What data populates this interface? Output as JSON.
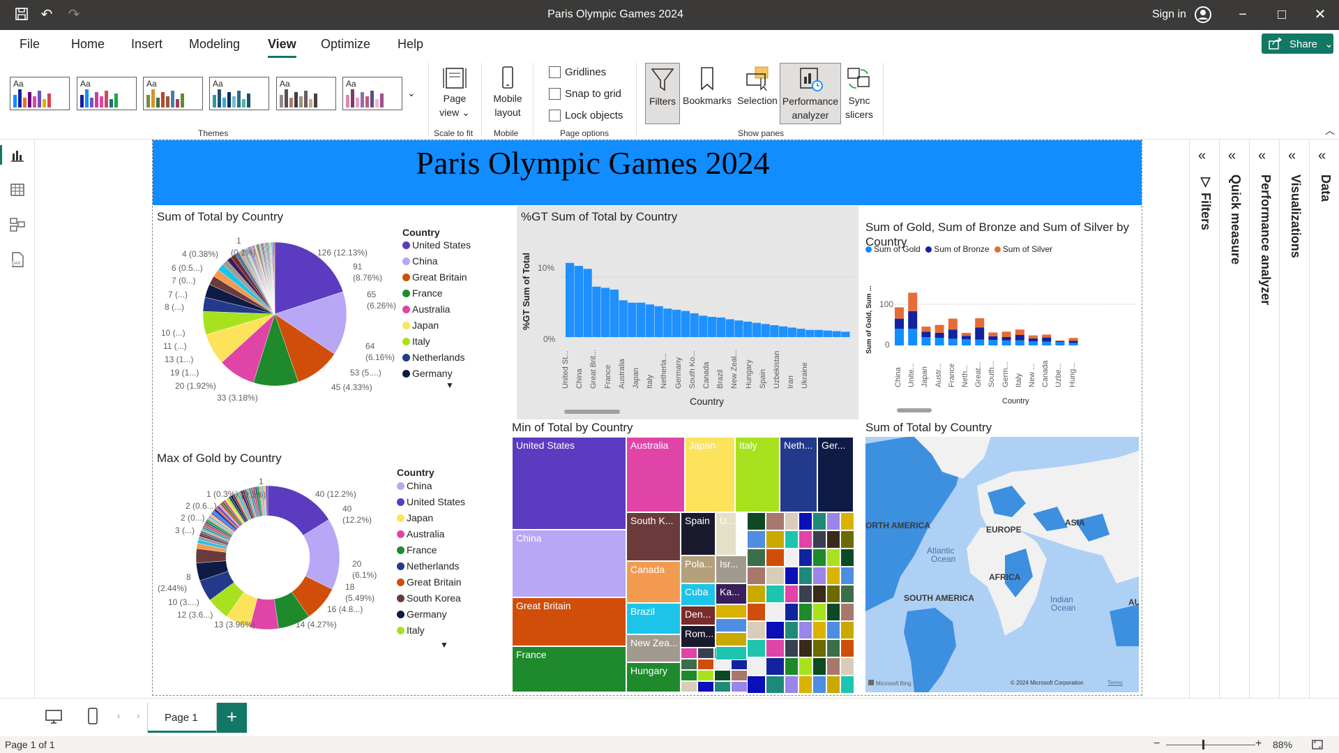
{
  "app": {
    "title": "Paris Olympic Games 2024",
    "sign_in": "Sign in",
    "share_label": "Share"
  },
  "ribbon_tabs": [
    "File",
    "Home",
    "Insert",
    "Modeling",
    "View",
    "Optimize",
    "Help"
  ],
  "active_tab": "View",
  "ribbon": {
    "themes_label": "Themes",
    "theme_tile_label": "Aa",
    "page_view": "Page view",
    "scale_to_fit": "Scale to fit",
    "mobile_layout": "Mobile layout",
    "mobile": "Mobile",
    "gridlines": "Gridlines",
    "snap_to_grid": "Snap to grid",
    "lock_objects": "Lock objects",
    "page_options": "Page options",
    "filters": "Filters",
    "bookmarks": "Bookmarks",
    "selection": "Selection",
    "performance_analyzer": "Performance analyzer",
    "sync_slicers": "Sync slicers",
    "show_panes": "Show panes"
  },
  "report": {
    "banner_title": "Paris Olympic Games 2024",
    "pie1": {
      "title": "Sum of Total by Country",
      "legend_title": "Country",
      "legend": [
        {
          "name": "United States",
          "color": "#5b3bbf"
        },
        {
          "name": "China",
          "color": "#b8a7f5"
        },
        {
          "name": "Great Britain",
          "color": "#d04e0a"
        },
        {
          "name": "France",
          "color": "#1e8a2c"
        },
        {
          "name": "Australia",
          "color": "#e044a7"
        },
        {
          "name": "Japan",
          "color": "#fde35b"
        },
        {
          "name": "Italy",
          "color": "#a8e21e"
        },
        {
          "name": "Netherlands",
          "color": "#233a8c"
        },
        {
          "name": "Germany",
          "color": "#0d1b45"
        }
      ],
      "labels": [
        "1",
        "4 (0.38%)",
        "(0.1%)",
        "126 (12.13%)",
        "6 (0.5...)",
        "91",
        "(8.76%)",
        "7 (0...)",
        "7 (...)",
        "65",
        "(6.26%)",
        "8 (...)",
        "10 (...)",
        "11 (...)",
        "64",
        "(6.16%)",
        "13 (1...)",
        "53 (5....)",
        "19 (1...)",
        "20 (1.92%)",
        "45 (4.33%)",
        "33 (3.18%)"
      ],
      "slices": [
        126,
        91,
        65,
        64,
        53,
        45,
        33,
        20,
        19,
        13,
        11,
        10,
        8,
        7,
        7,
        6,
        4,
        1
      ]
    },
    "donut": {
      "title": "Max of Gold by Country",
      "legend_title": "Country",
      "legend": [
        {
          "name": "China",
          "color": "#b8a7f5"
        },
        {
          "name": "United States",
          "color": "#5b3bbf"
        },
        {
          "name": "Japan",
          "color": "#fde35b"
        },
        {
          "name": "Australia",
          "color": "#e044a7"
        },
        {
          "name": "France",
          "color": "#1e8a2c"
        },
        {
          "name": "Netherlands",
          "color": "#233a8c"
        },
        {
          "name": "Great Britain",
          "color": "#d04e0a"
        },
        {
          "name": "South Korea",
          "color": "#6b3b3b"
        },
        {
          "name": "Germany",
          "color": "#0d1b45"
        },
        {
          "name": "Italy",
          "color": "#a8e21e"
        }
      ],
      "labels": [
        "1",
        "1 (0.3%)",
        "(0.3%)",
        "40 (12.2%)",
        "2 (0.6...)",
        "40",
        "(12.2%)",
        "2 (0...)",
        "3 (...)",
        "20",
        "(6.1%)",
        "8",
        "(2.44%)",
        "18",
        "(5.49%)",
        "10 (3....)",
        "16 (4.8...)",
        "12 (3.6...)",
        "14 (4.27%)",
        "13 (3.96%)"
      ],
      "slices": [
        40,
        40,
        20,
        18,
        16,
        14,
        13,
        12,
        10,
        8,
        3,
        2,
        2,
        1,
        1
      ]
    },
    "gt_chart": {
      "title": "%GT Sum of Total by Country",
      "ylabel": "%GT Sum of Total",
      "xlabel": "Country",
      "yticks": [
        "10%",
        "0%"
      ],
      "categories": [
        "United St...",
        "China",
        "Great Brit...",
        "France",
        "Australia",
        "Japan",
        "Italy",
        "Netherla...",
        "Germany",
        "South Ko...",
        "Canada",
        "Brazil",
        "New Zeal...",
        "Hungary",
        "Spain",
        "Uzbekistan",
        "Iran",
        "Ukraine"
      ]
    },
    "stacked": {
      "title": "Sum of Gold, Sum of Bronze and Sum of Silver by Country",
      "legend": [
        {
          "name": "Sum of Gold",
          "color": "#118dff"
        },
        {
          "name": "Sum of Bronze",
          "color": "#12239e"
        },
        {
          "name": "Sum of Silver",
          "color": "#e66c37"
        }
      ],
      "ylabel": "Sum of Gold, Sum ...",
      "xlabel": "Country",
      "yticks": [
        "100",
        "0"
      ],
      "categories": [
        "China",
        "Unite...",
        "Japan",
        "Austr...",
        "France",
        "Neth...",
        "Great...",
        "South...",
        "Germ...",
        "Italy",
        "New ...",
        "Canada",
        "Uzbe...",
        "Hung..."
      ]
    },
    "treemap": {
      "title": "Min of Total by Country",
      "labels": [
        "United States",
        "China",
        "Great Britain",
        "France",
        "Australia",
        "Japan",
        "Italy",
        "Neth...",
        "Ger...",
        "South K...",
        "Spain",
        "U...",
        "Canada",
        "Pola...",
        "Cuba",
        "Brazil",
        "Isr...",
        "Ka...",
        "Den...",
        "Rom...",
        "New Zea...",
        "Hungary"
      ]
    },
    "map": {
      "title": "Sum of Total by Country",
      "labels": [
        "ORTH AMERICA",
        "EUROPE",
        "ASIA",
        "Atlantic",
        "Ocean",
        "AFRICA",
        "SOUTH AMERICA",
        "Indian",
        "Ocean",
        "AU"
      ],
      "attribution": "© 2024 Microsoft Corporation",
      "terms": "Terms",
      "bing": "Microsoft Bing"
    }
  },
  "panes": [
    "Filters",
    "Quick measure",
    "Performance analyzer",
    "Visualizations",
    "Data"
  ],
  "pages": {
    "tab": "Page 1",
    "add": "+"
  },
  "status": {
    "page_info": "Page 1 of 1",
    "zoom": "88%"
  }
}
